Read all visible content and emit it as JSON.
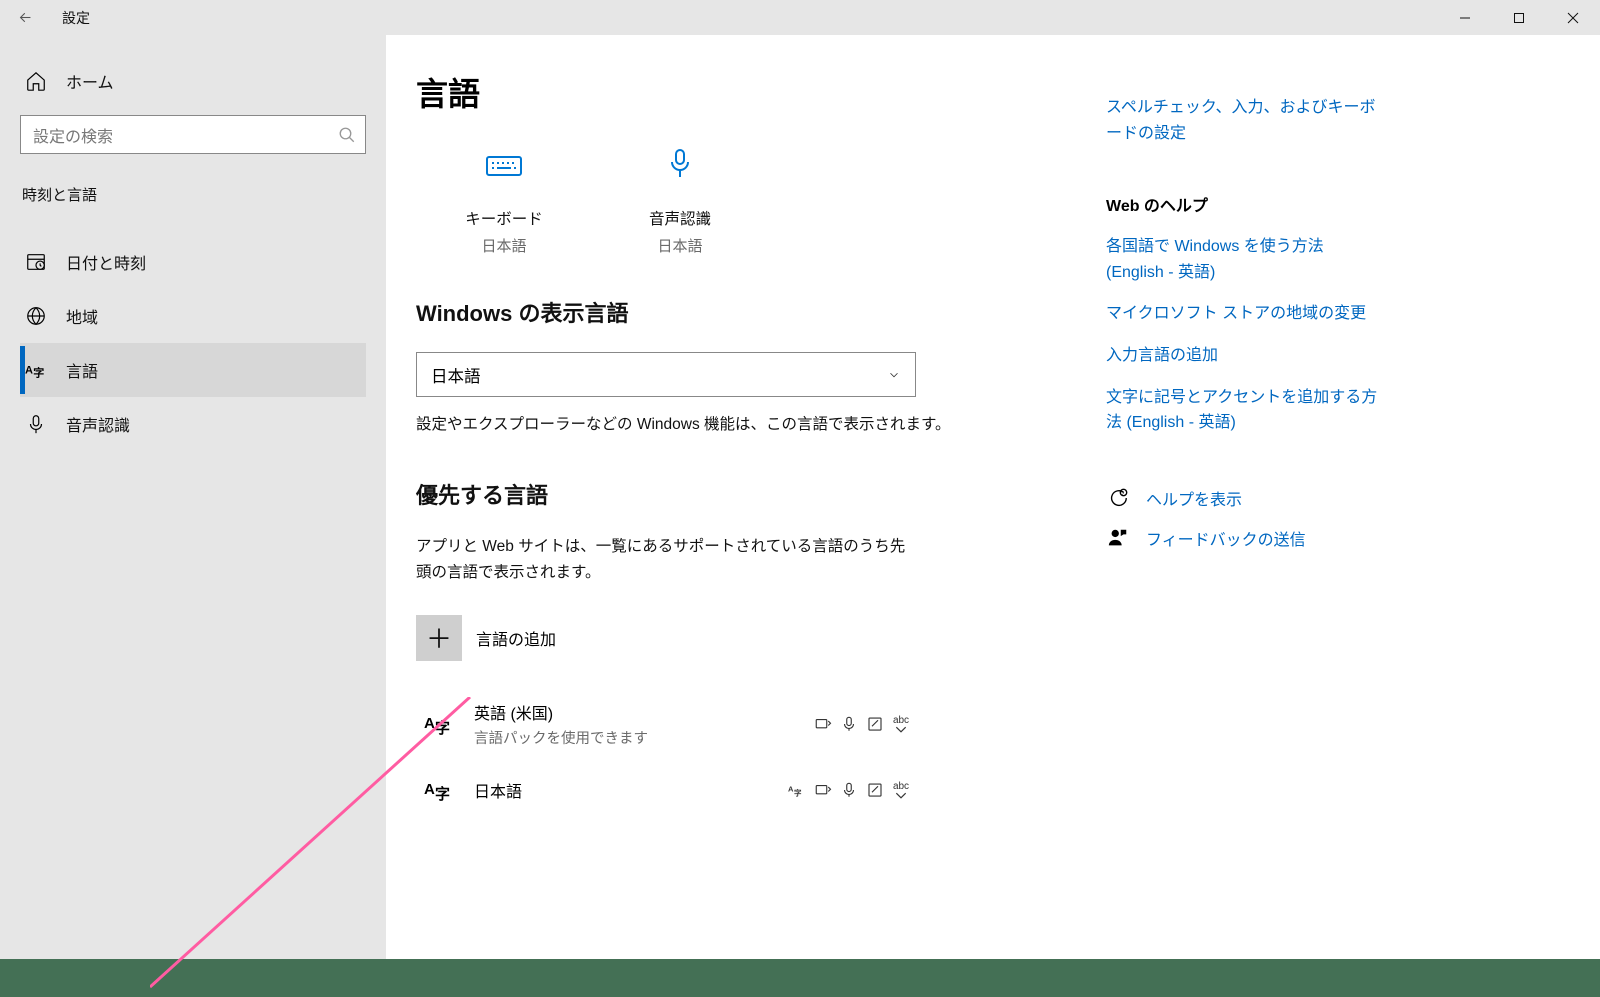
{
  "titlebar": {
    "title": "設定"
  },
  "sidebar": {
    "home_label": "ホーム",
    "search_placeholder": "設定の検索",
    "category": "時刻と言語",
    "items": [
      {
        "label": "日付と時刻"
      },
      {
        "label": "地域"
      },
      {
        "label": "言語"
      },
      {
        "label": "音声認識"
      }
    ]
  },
  "main": {
    "heading": "言語",
    "tiles": {
      "keyboard": {
        "label": "キーボード",
        "sub": "日本語"
      },
      "speech": {
        "label": "音声認識",
        "sub": "日本語"
      }
    },
    "display_lang": {
      "heading": "Windows の表示言語",
      "selected": "日本語",
      "hint": "設定やエクスプローラーなどの Windows 機能は、この言語で表示されます。"
    },
    "preferred": {
      "heading": "優先する言語",
      "desc": "アプリと Web サイトは、一覧にあるサポートされている言語のうち先頭の言語で表示されます。",
      "add_label": "言語の追加",
      "items": [
        {
          "name": "英語 (米国)",
          "sub": "言語パックを使用できます"
        },
        {
          "name": "日本語",
          "sub": ""
        }
      ]
    }
  },
  "right": {
    "top_link": "スペルチェック、入力、およびキーボードの設定",
    "web_help_heading": "Web のヘルプ",
    "links": [
      "各国語で Windows を使う方法 (English - 英語)",
      "マイクロソフト ストアの地域の変更",
      "入力言語の追加",
      "文字に記号とアクセントを追加する方法 (English - 英語)"
    ],
    "help_label": "ヘルプを表示",
    "feedback_label": "フィードバックの送信"
  }
}
